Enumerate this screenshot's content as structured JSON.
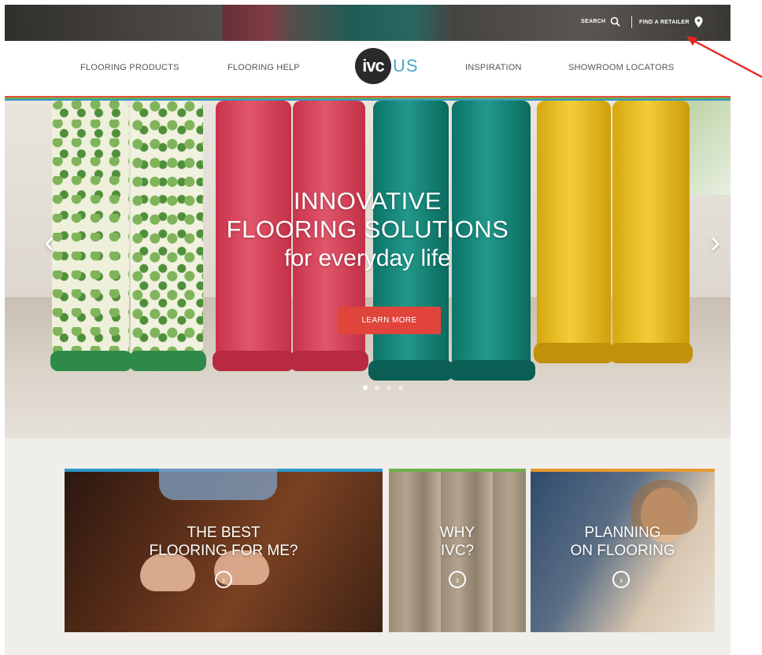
{
  "top_bar": {
    "search_label": "SEARCH",
    "retailer_label": "FIND A RETAILER"
  },
  "nav": {
    "items": [
      {
        "label": "FLOORING PRODUCTS"
      },
      {
        "label": "FLOORING HELP"
      },
      {
        "label": "INSPIRATION"
      },
      {
        "label": "SHOWROOM LOCATORS"
      }
    ],
    "logo": {
      "mark": "ivc",
      "suffix": "US"
    }
  },
  "hero": {
    "title_line1": "INNOVATIVE",
    "title_line2": "FLOORING SOLUTIONS",
    "subtitle": "for everyday life",
    "cta_label": "LEARN MORE",
    "slide_count": 4,
    "active_slide": 1
  },
  "cards": [
    {
      "line1": "THE BEST",
      "line2": "FLOORING FOR ME?",
      "accent": "#2f98c8"
    },
    {
      "line1": "WHY",
      "line2": "IVC?",
      "accent": "#6cb04a"
    },
    {
      "line1": "PLANNING",
      "line2": "ON FLOORING",
      "accent": "#e89a2c"
    }
  ],
  "colors": {
    "cta": "#e0443b",
    "stripe_red": "#e3513d",
    "stripe_green": "#6cb04a",
    "stripe_blue": "#2f98c8",
    "annotation_arrow": "#e8261f"
  },
  "icons": [
    "search-icon",
    "map-pin-icon",
    "chevron-left-icon",
    "chevron-right-icon",
    "circle-arrow-icon",
    "annotation-arrow"
  ]
}
